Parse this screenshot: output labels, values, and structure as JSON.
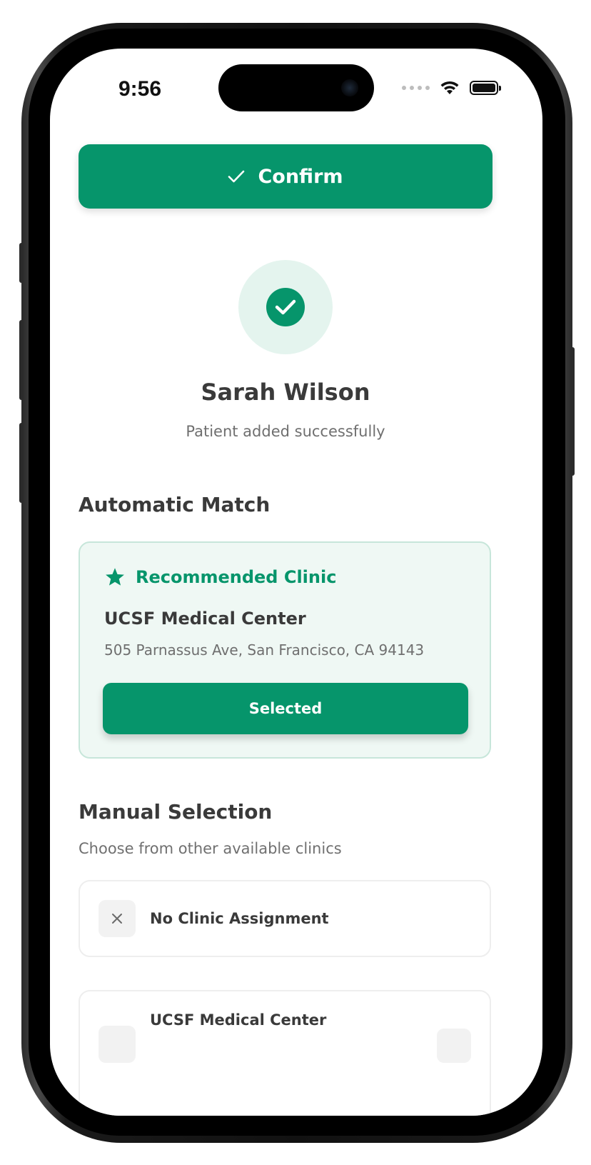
{
  "status_bar": {
    "time": "9:56"
  },
  "actions": {
    "confirm_label": "Confirm"
  },
  "patient": {
    "name": "Sarah Wilson",
    "status_text": "Patient added successfully"
  },
  "automatic_match": {
    "title": "Automatic Match",
    "badge_label": "Recommended Clinic",
    "clinic_name": "UCSF Medical Center",
    "clinic_address": "505 Parnassus Ave, San Francisco, CA 94143",
    "selected_label": "Selected"
  },
  "manual_selection": {
    "title": "Manual Selection",
    "subtitle": "Choose from other available clinics",
    "options": [
      {
        "label": "No Clinic Assignment",
        "icon": "close-icon"
      },
      {
        "label": "UCSF Medical Center",
        "icon": "clinic-icon"
      }
    ]
  },
  "colors": {
    "brand_green": "#06956b",
    "success_bg": "#e4f4ee",
    "card_bg": "#eff8f4",
    "card_border": "#c7e6da"
  }
}
